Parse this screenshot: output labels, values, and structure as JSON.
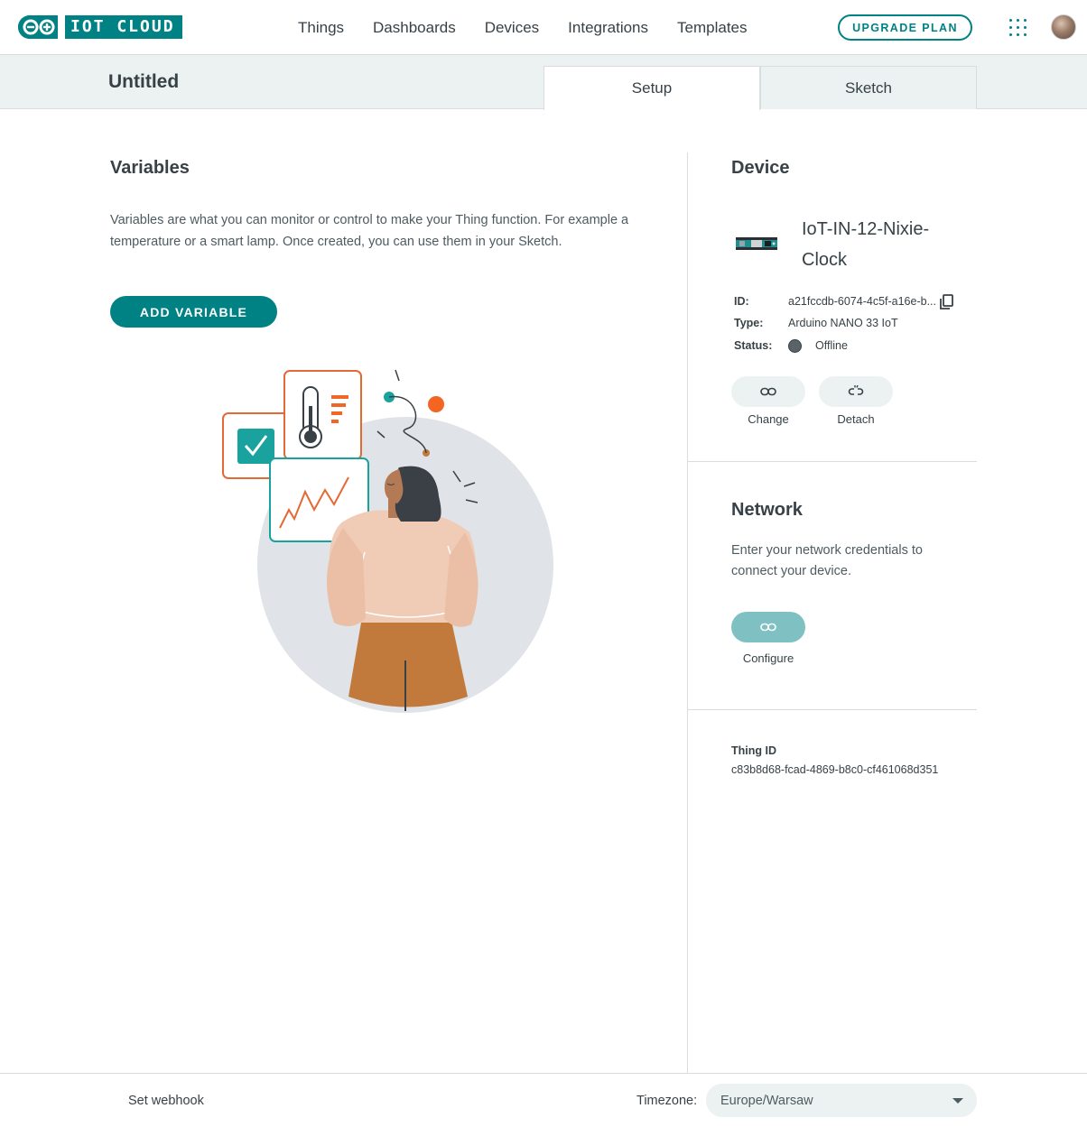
{
  "brand": {
    "logo_text": "IOT CLOUD"
  },
  "nav": {
    "items": [
      "Things",
      "Dashboards",
      "Devices",
      "Integrations",
      "Templates"
    ]
  },
  "header": {
    "upgrade_label": "UPGRADE PLAN",
    "apps_icon": "apps-grid-icon",
    "avatar": "user-avatar"
  },
  "thing": {
    "title": "Untitled",
    "tabs": [
      "Setup",
      "Sketch"
    ],
    "active_tab": "Setup"
  },
  "variables": {
    "title": "Variables",
    "description": "Variables are what you can monitor or control to make your Thing function. For example a temperature or a smart lamp. Once created, you can use them in your Sketch.",
    "add_label": "ADD VARIABLE"
  },
  "device": {
    "title": "Device",
    "name": "IoT-IN-12-Nixie-Clock",
    "id_label": "ID:",
    "id_value": "a21fccdb-6074-4c5f-a16e-b...",
    "type_label": "Type:",
    "type_value": "Arduino NANO 33 IoT",
    "status_label": "Status:",
    "status_value": "Offline",
    "change_label": "Change",
    "detach_label": "Detach"
  },
  "network": {
    "title": "Network",
    "description": "Enter your network credentials to connect your device.",
    "configure_label": "Configure"
  },
  "thing_id": {
    "label": "Thing ID",
    "value": "c83b8d68-fcad-4869-b8c0-cf461068d351"
  },
  "footer": {
    "webhook_label": "Set webhook",
    "timezone_label": "Timezone:",
    "timezone_value": "Europe/Warsaw"
  },
  "colors": {
    "brand_teal": "#008184",
    "light_teal": "#7fc1c2",
    "bg_grey": "#ecf1f1",
    "offline_grey": "#58636a"
  }
}
